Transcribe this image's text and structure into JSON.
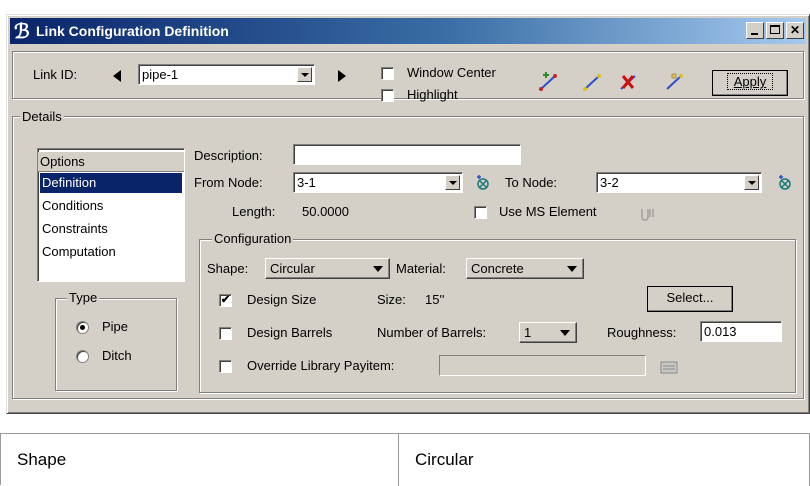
{
  "window": {
    "title": "Link Configuration Definition",
    "app_icon": "bentley-b-icon",
    "controls": [
      "minimize-icon",
      "maximize-icon",
      "close-icon"
    ]
  },
  "toolbar": {
    "link_id_label": "Link ID:",
    "link_id_value": "pipe-1",
    "window_center_label": "Window Center",
    "window_center_checked": false,
    "highlight_label": "Highlight",
    "highlight_checked": false,
    "tool_icons": [
      "link-add-icon",
      "link-select-icon",
      "link-delete-icon",
      "link-edit-icon"
    ],
    "apply_label": "Apply"
  },
  "details": {
    "legend": "Details",
    "options": {
      "header": "Options",
      "items": [
        "Definition",
        "Conditions",
        "Constraints",
        "Computation"
      ],
      "selected": "Definition"
    },
    "type": {
      "legend": "Type",
      "options": [
        "Pipe",
        "Ditch"
      ],
      "selected": "Pipe"
    },
    "description_label": "Description:",
    "description_value": "",
    "from_node_label": "From Node:",
    "from_node_value": "3-1",
    "to_node_label": "To Node:",
    "to_node_value": "3-2",
    "length_label": "Length:",
    "length_value": "50.0000",
    "use_ms_element_label": "Use MS Element",
    "use_ms_element_checked": false
  },
  "configuration": {
    "legend": "Configuration",
    "shape_label": "Shape:",
    "shape_value": "Circular",
    "material_label": "Material:",
    "material_value": "Concrete",
    "design_size_label": "Design Size",
    "design_size_checked": true,
    "size_label": "Size:",
    "size_value": "15''",
    "select_label": "Select...",
    "design_barrels_label": "Design Barrels",
    "design_barrels_checked": false,
    "number_of_barrels_label": "Number of Barrels:",
    "number_of_barrels_value": "1",
    "roughness_label": "Roughness:",
    "roughness_value": "0.013",
    "override_payitem_label": "Override Library Payitem:",
    "override_payitem_checked": false,
    "override_payitem_value": ""
  },
  "table": {
    "rows": [
      [
        "Shape",
        "Circular"
      ]
    ]
  },
  "colors": {
    "title_bar_start": "#0a246a",
    "title_bar_end": "#a6caf0",
    "dialog_face": "#d4d0c8",
    "selection": "#0a246a"
  }
}
